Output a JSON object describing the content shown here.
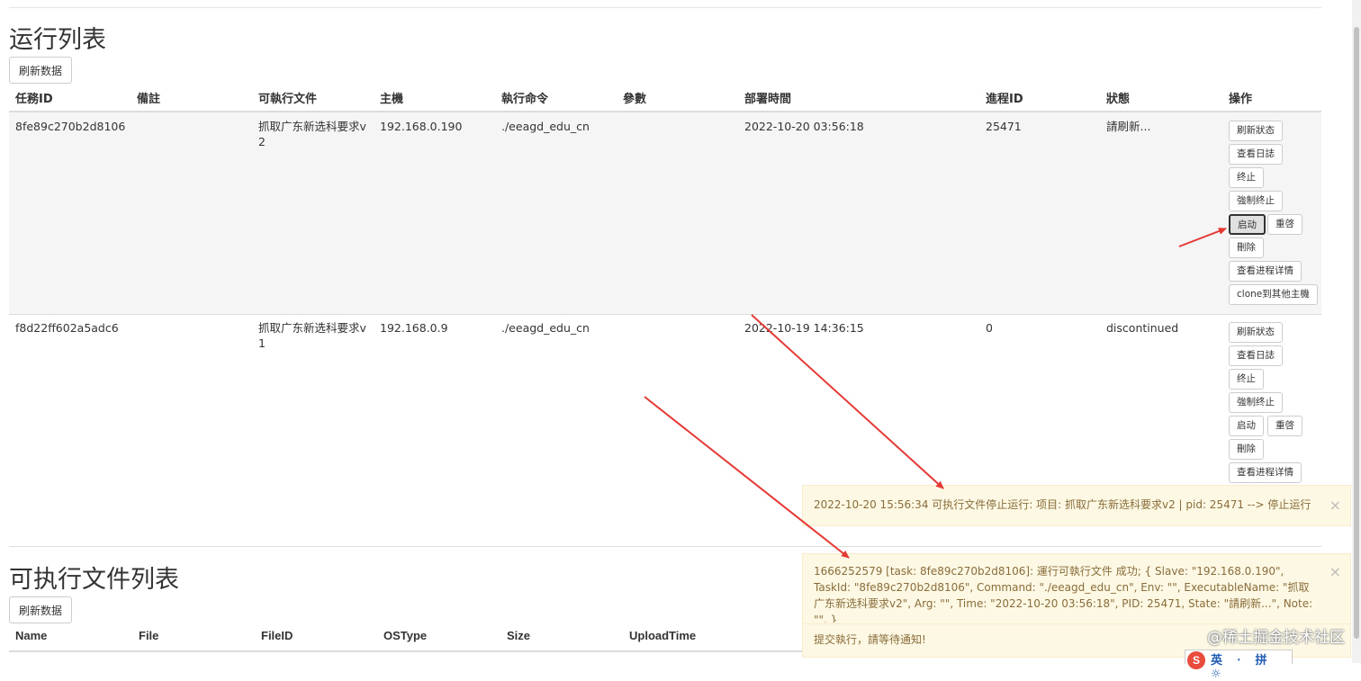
{
  "run_list": {
    "title": "运行列表",
    "refresh_label": "刷新数据",
    "headers": [
      "任務ID",
      "備註",
      "可執行文件",
      "主機",
      "執行命令",
      "參數",
      "部署時間",
      "進程ID",
      "狀態",
      "操作"
    ],
    "rows": [
      {
        "task_id": "8fe89c270b2d8106",
        "note": "",
        "executable_line1": "抓取广东新选科要求v",
        "executable_line2": "2",
        "host": "192.168.0.190",
        "command": "./eeagd_edu_cn",
        "args": "",
        "deploy_time": "2022-10-20 03:56:18",
        "pid": "25471",
        "state": "請刷新..."
      },
      {
        "task_id": "f8d22ff602a5adc6",
        "note": "",
        "executable_line1": "抓取广东新选科要求v",
        "executable_line2": "1",
        "host": "192.168.0.9",
        "command": "./eeagd_edu_cn",
        "args": "",
        "deploy_time": "2022-10-19 14:36:15",
        "pid": "0",
        "state": "discontinued"
      }
    ],
    "actions": {
      "refresh_state": "刷新狀态",
      "view_log": "查看日誌",
      "stop": "终止",
      "force_stop": "強制终止",
      "start": "启动",
      "restart": "重啓",
      "delete": "刪除",
      "process_detail": "查看进程详情",
      "clone": "clone到其他主機"
    }
  },
  "exec_list": {
    "title": "可执行文件列表",
    "refresh_label": "刷新数据",
    "headers": [
      "Name",
      "File",
      "FileID",
      "OSType",
      "Size",
      "UploadTime"
    ]
  },
  "toasts": [
    {
      "text": "2022-10-20 15:56:34 可执行文件停止运行: 项目: 抓取广东新选科要求v2 | pid: 25471 --> 停止运行",
      "close": "×"
    },
    {
      "text": "1666252579 [task: 8fe89c270b2d8106]: 運行可執行文件 成功; { Slave: \"192.168.0.190\", TaskId: \"8fe89c270b2d8106\", Command: \"./eeagd_edu_cn\", Env: \"\", ExecutableName: \"抓取广东新选科要求v2\", Arg: \"\", Time: \"2022-10-20 03:56:18\", PID: 25471, State: \"請刷新...\", Note: \"\", }",
      "footer": "提交執行，請等待通知!",
      "close": "×"
    }
  ],
  "watermark": "@稀土掘金技术社区",
  "ime": {
    "logo": "S",
    "text": "英 ⸱ 拼 ☼"
  },
  "colors": {
    "toast_bg": "#fcf8e3",
    "toast_text": "#8a6d3b",
    "arrow": "#e53935",
    "stripe": "#f5f5f5"
  }
}
